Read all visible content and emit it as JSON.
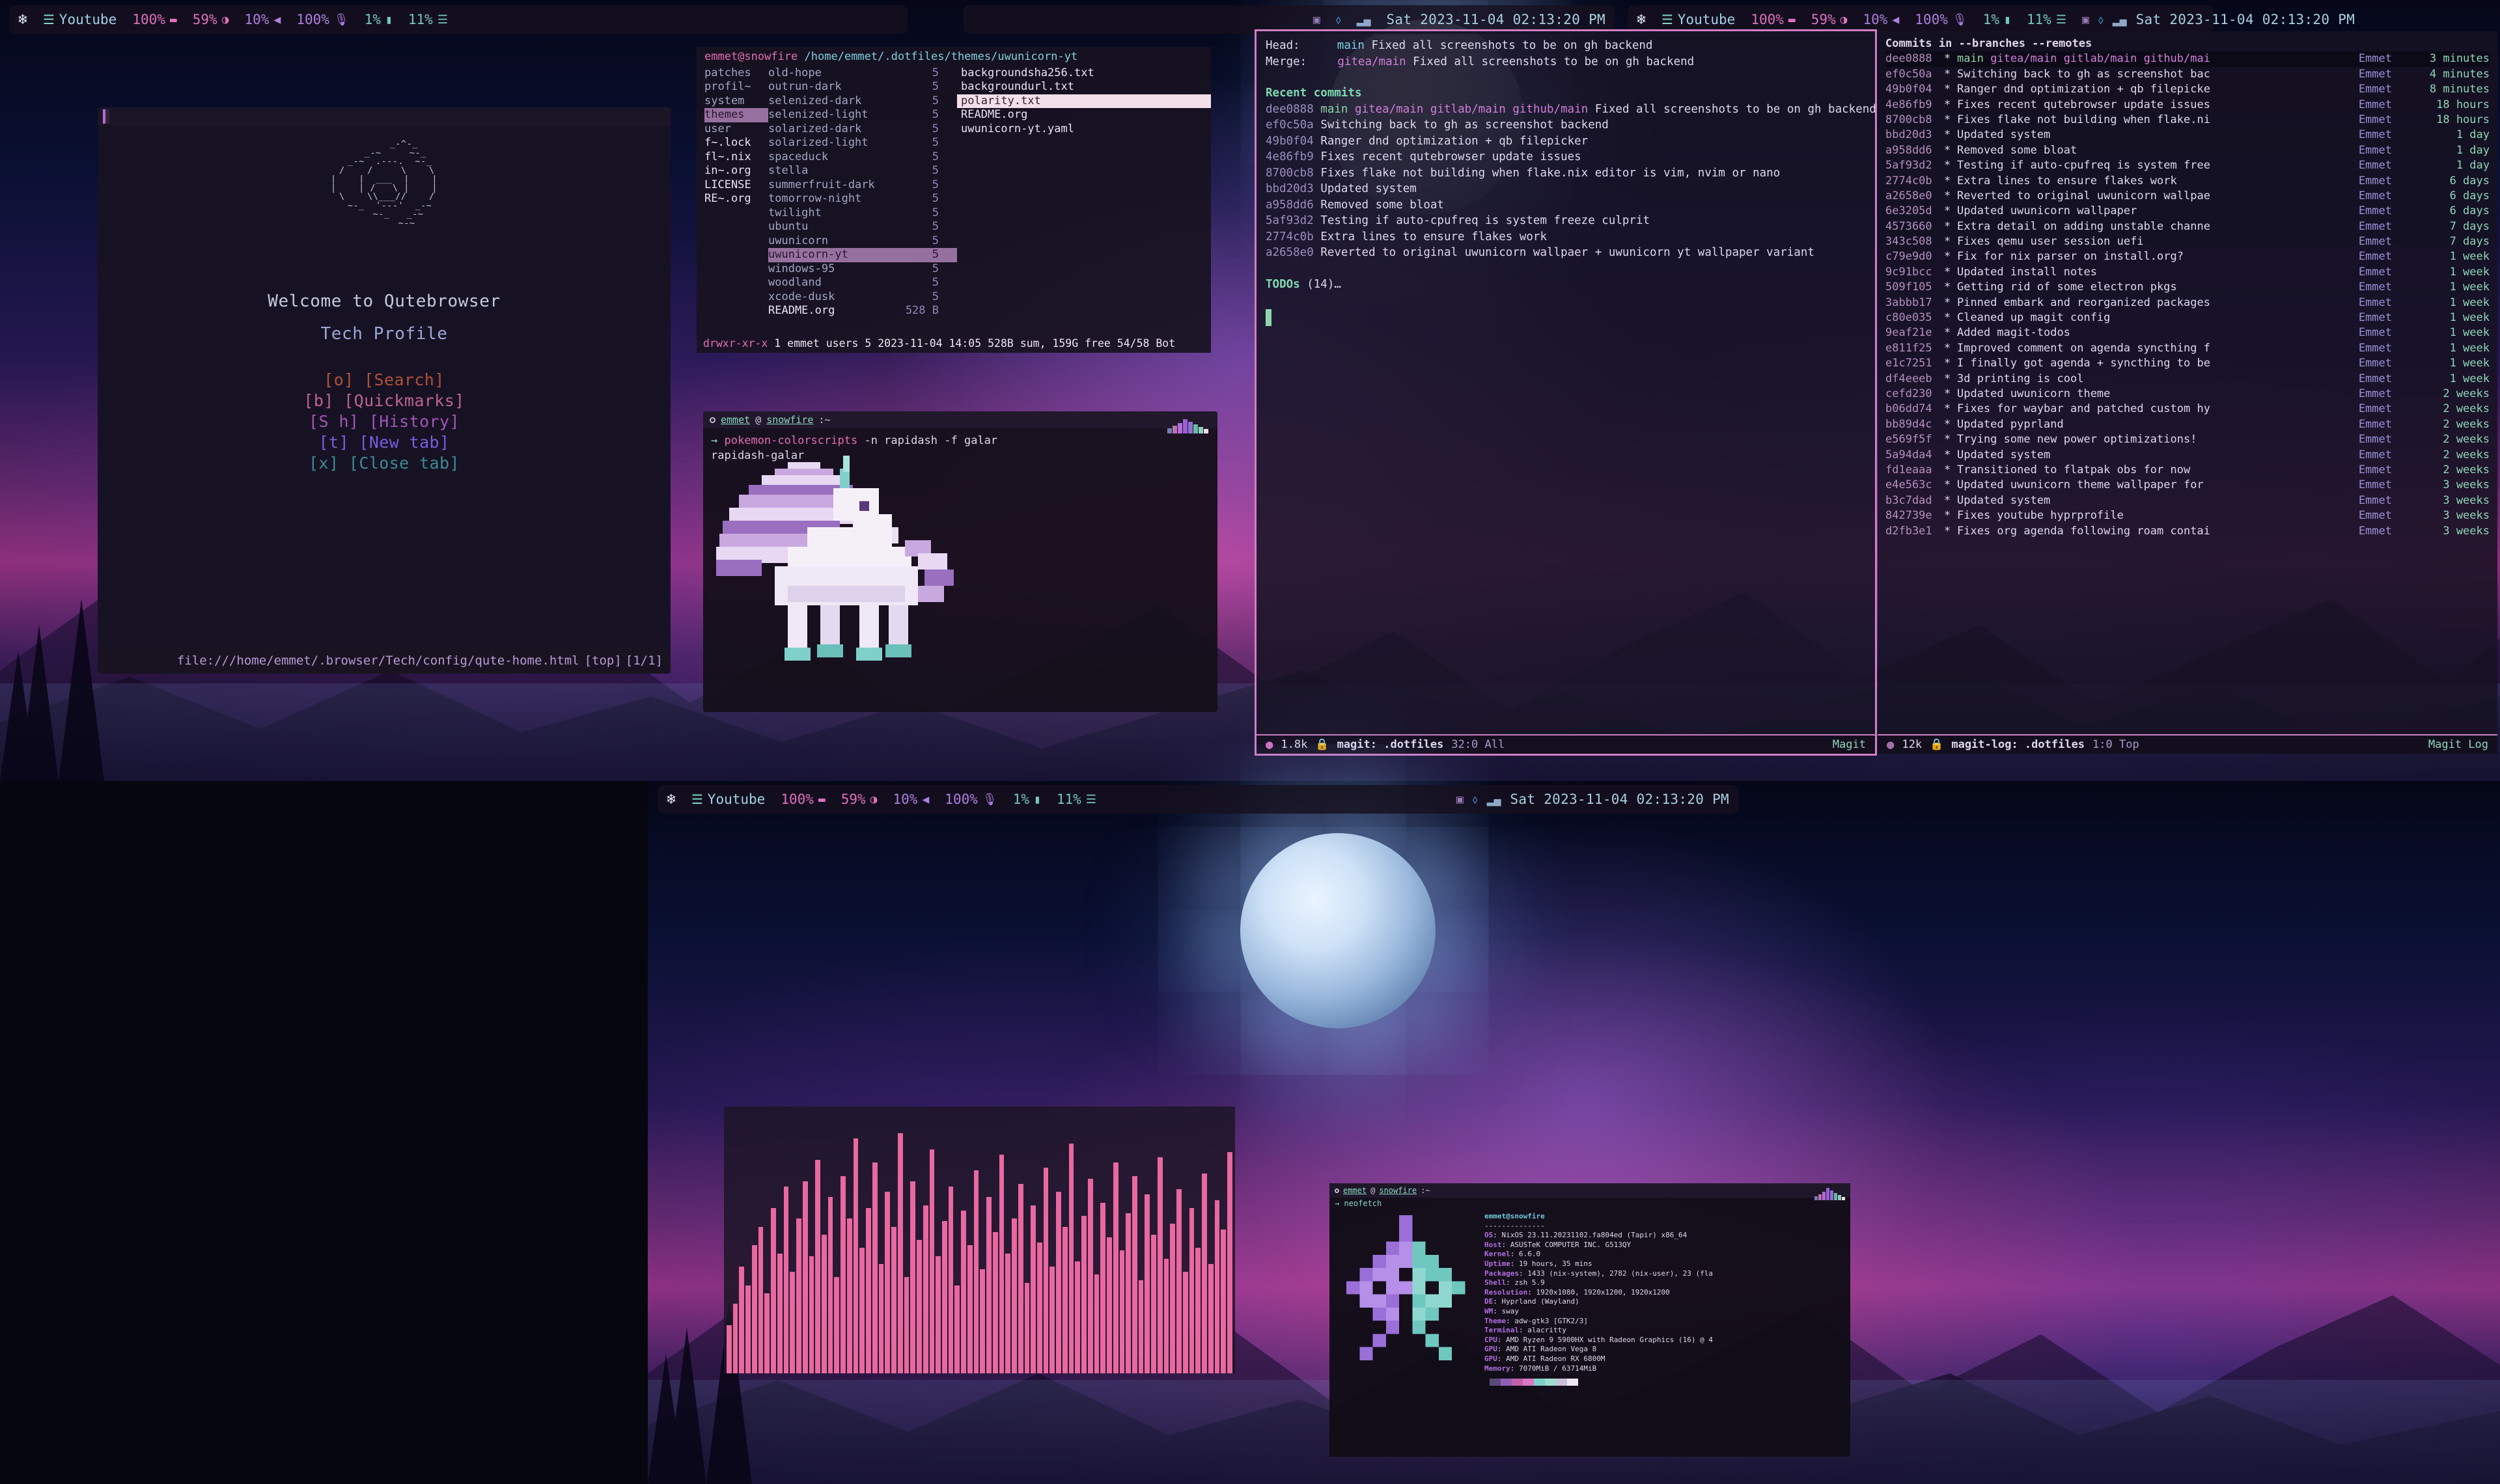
{
  "waybar": {
    "nix_icon": "nix-snowflake-icon",
    "workspace_icon": "layers-icon",
    "workspace_label": "Youtube",
    "brightness": "100%",
    "brightness_icon": "brightness-icon",
    "battery": "59%",
    "battery_icon": "battery-half-icon",
    "volume": "10%",
    "volume_icon": "speaker-icon",
    "mic": "100%",
    "mic_icon": "microphone-icon",
    "cpu": "1%",
    "cpu_icon": "cpu-icon",
    "memory": "11%",
    "memory_icon": "memory-icon",
    "tray_icons": [
      "display-off-icon",
      "bluetooth-icon",
      "network-signal-icon"
    ],
    "clock": "Sat 2023-11-04 02:13:20 PM"
  },
  "qutebrowser": {
    "ascii_art": "       _-^-_\n    _-~     ~-_\n  _-~  .---.  ~-_\n /    /     \\    \\\n|    |  ___  |    |\n|    | /   \\ |    |\n \\    \\\\___//    /\n  ~-_  '---'  _-~\n     ~-_   _-~\n        ~-~",
    "welcome": "Welcome to Qutebrowser",
    "subtitle": "Tech Profile",
    "links": [
      {
        "key": "[o]",
        "label": "[Search]",
        "color": "#b1503a"
      },
      {
        "key": "[b]",
        "label": "[Quickmarks]",
        "color": "#c0628f"
      },
      {
        "key": "[S h]",
        "label": "[History]",
        "color": "#a453b8"
      },
      {
        "key": "[t]",
        "label": "[New tab]",
        "color": "#7b5ce0"
      },
      {
        "key": "[x]",
        "label": "[Close tab]",
        "color": "#3d8a93"
      }
    ],
    "status_url": "file:///home/emmet/.browser/Tech/config/qute-home.html",
    "status_scroll": "[top]",
    "status_tabs": "[1/1]"
  },
  "ranger": {
    "user_host": "emmet@snowfire",
    "path": "/home/emmet/.dotfiles/themes/uwunicorn-yt",
    "col1": [
      {
        "name": "patches",
        "type": "dir"
      },
      {
        "name": "profil~",
        "type": "dir"
      },
      {
        "name": "system",
        "type": "dir"
      },
      {
        "name": "themes",
        "type": "dir",
        "selected": true
      },
      {
        "name": "user",
        "type": "dir"
      },
      {
        "name": "f~.lock",
        "type": "file"
      },
      {
        "name": "fl~.nix",
        "type": "file"
      },
      {
        "name": "in~.org",
        "type": "file"
      },
      {
        "name": "LICENSE",
        "type": "file"
      },
      {
        "name": "RE~.org",
        "type": "file"
      }
    ],
    "col2": [
      {
        "name": "old-hope",
        "size": "5"
      },
      {
        "name": "outrun-dark",
        "size": "5"
      },
      {
        "name": "selenized-dark",
        "size": "5"
      },
      {
        "name": "selenized-light",
        "size": "5"
      },
      {
        "name": "solarized-dark",
        "size": "5"
      },
      {
        "name": "solarized-light",
        "size": "5"
      },
      {
        "name": "spaceduck",
        "size": "5"
      },
      {
        "name": "stella",
        "size": "5"
      },
      {
        "name": "summerfruit-dark",
        "size": "5"
      },
      {
        "name": "tomorrow-night",
        "size": "5"
      },
      {
        "name": "twilight",
        "size": "5"
      },
      {
        "name": "ubuntu",
        "size": "5"
      },
      {
        "name": "uwunicorn",
        "size": "5"
      },
      {
        "name": "uwunicorn-yt",
        "size": "5",
        "selected": true
      },
      {
        "name": "windows-95",
        "size": "5"
      },
      {
        "name": "woodland",
        "size": "5"
      },
      {
        "name": "xcode-dusk",
        "size": "5"
      },
      {
        "name": "README.org",
        "size": "528 B",
        "file": true
      }
    ],
    "col3": [
      {
        "name": "backgroundsha256.txt"
      },
      {
        "name": "backgroundurl.txt"
      },
      {
        "name": "polarity.txt",
        "selected": true
      },
      {
        "name": "README.org"
      },
      {
        "name": "uwunicorn-yt.yaml"
      }
    ],
    "statusline_perm": "drwxr-xr-x",
    "statusline_rest": "1 emmet users 5 2023-11-04 14:05 528B sum, 159G free  54/58  Bot"
  },
  "pokemon_terminal": {
    "title_user": "emmet",
    "title_at": "@",
    "title_host": "snowfire",
    "title_path": ":~",
    "prompt_arrow": "→",
    "command": "pokemon-colorscripts",
    "args": "-n rapidash -f galar",
    "output": "rapidash-galar",
    "swatch_colors": [
      "#6f7fb8",
      "#c06fb0",
      "#b06fd8",
      "#9a5fd8",
      "#8f6fd0",
      "#6fb8a8",
      "#8fd0c0",
      "#f0dce8"
    ],
    "swatch_heights": [
      8,
      12,
      16,
      22,
      18,
      14,
      10,
      7
    ],
    "pokemon_name": "rapidash-galar",
    "pokemon_colors": {
      "mane_light": "#e8d8f2",
      "mane_mid": "#c9a8e0",
      "mane_dark": "#9a6fc0",
      "body": "#f5f0f8",
      "accent": "#7fd0c8",
      "shadow": "#6a4a8a"
    }
  },
  "magit": {
    "head_label": "Head:",
    "head_branch": "main",
    "head_msg": "Fixed all screenshots to be on gh backend",
    "merge_label": "Merge:",
    "merge_branch": "gitea/main",
    "merge_msg": "Fixed all screenshots to be on gh backend",
    "recent_commits_label": "Recent commits",
    "commits": [
      {
        "hash": "dee0888",
        "refs": [
          "main",
          "gitea/main",
          "gitlab/main",
          "github/main"
        ],
        "msg": "Fixed all screenshots to be on gh backend"
      },
      {
        "hash": "ef0c50a",
        "refs": [],
        "msg": "Switching back to gh as screenshot backend"
      },
      {
        "hash": "49b0f04",
        "refs": [],
        "msg": "Ranger dnd optimization + qb filepicker"
      },
      {
        "hash": "4e86fb9",
        "refs": [],
        "msg": "Fixes recent qutebrowser update issues"
      },
      {
        "hash": "8700cb8",
        "refs": [],
        "msg": "Fixes flake not building when flake.nix editor is vim, nvim or nano"
      },
      {
        "hash": "bbd20d3",
        "refs": [],
        "msg": "Updated system"
      },
      {
        "hash": "a958dd6",
        "refs": [],
        "msg": "Removed some bloat"
      },
      {
        "hash": "5af93d2",
        "refs": [],
        "msg": "Testing if auto-cpufreq is system freeze culprit"
      },
      {
        "hash": "2774c0b",
        "refs": [],
        "msg": "Extra lines to ensure flakes work"
      },
      {
        "hash": "a2658e0",
        "refs": [],
        "msg": "Reverted to original uwunicorn wallpaer + uwunicorn yt wallpaper variant"
      }
    ],
    "todos_label": "TODOs",
    "todos_count": "(14)…",
    "modeline": {
      "size": "1.8k",
      "lock_icon": "lock-icon",
      "buffer": "magit: .dotfiles",
      "position": "32:0 All",
      "mode": "Magit"
    }
  },
  "magit_log": {
    "header": "Commits in --branches --remotes",
    "rows": [
      {
        "hash": "dee0888",
        "msg": "main gitea/main gitlab/main github/mai",
        "refs": true,
        "author": "Emmet",
        "age": "3 minutes",
        "current": true
      },
      {
        "hash": "ef0c50a",
        "msg": "Switching back to gh as screenshot bac",
        "author": "Emmet",
        "age": "4 minutes"
      },
      {
        "hash": "49b0f04",
        "msg": "Ranger dnd optimization + qb filepicke",
        "author": "Emmet",
        "age": "8 minutes"
      },
      {
        "hash": "4e86fb9",
        "msg": "Fixes recent qutebrowser update issues",
        "author": "Emmet",
        "age": "18 hours"
      },
      {
        "hash": "8700cb8",
        "msg": "Fixes flake not building when flake.ni",
        "author": "Emmet",
        "age": "18 hours"
      },
      {
        "hash": "bbd20d3",
        "msg": "Updated system",
        "author": "Emmet",
        "age": "1 day"
      },
      {
        "hash": "a958dd6",
        "msg": "Removed some bloat",
        "author": "Emmet",
        "age": "1 day"
      },
      {
        "hash": "5af93d2",
        "msg": "Testing if auto-cpufreq is system free",
        "author": "Emmet",
        "age": "1 day"
      },
      {
        "hash": "2774c0b",
        "msg": "Extra lines to ensure flakes work",
        "author": "Emmet",
        "age": "6 days"
      },
      {
        "hash": "a2658e0",
        "msg": "Reverted to original uwunicorn wallpae",
        "author": "Emmet",
        "age": "6 days"
      },
      {
        "hash": "6e3205d",
        "msg": "Updated uwunicorn wallpaper",
        "author": "Emmet",
        "age": "6 days"
      },
      {
        "hash": "4573660",
        "msg": "Extra detail on adding unstable channe",
        "author": "Emmet",
        "age": "7 days"
      },
      {
        "hash": "343c508",
        "msg": "Fixes qemu user session uefi",
        "author": "Emmet",
        "age": "7 days"
      },
      {
        "hash": "c79e9d0",
        "msg": "Fix for nix parser on install.org?",
        "author": "Emmet",
        "age": "1 week"
      },
      {
        "hash": "9c91bcc",
        "msg": "Updated install notes",
        "author": "Emmet",
        "age": "1 week"
      },
      {
        "hash": "509f105",
        "msg": "Getting rid of some electron pkgs",
        "author": "Emmet",
        "age": "1 week"
      },
      {
        "hash": "3abbb17",
        "msg": "Pinned embark and reorganized packages",
        "author": "Emmet",
        "age": "1 week"
      },
      {
        "hash": "c80e035",
        "msg": "Cleaned up magit config",
        "author": "Emmet",
        "age": "1 week"
      },
      {
        "hash": "9eaf21e",
        "msg": "Added magit-todos",
        "author": "Emmet",
        "age": "1 week"
      },
      {
        "hash": "e811f25",
        "msg": "Improved comment on agenda syncthing f",
        "author": "Emmet",
        "age": "1 week"
      },
      {
        "hash": "e1c7251",
        "msg": "I finally got agenda + syncthing to be",
        "author": "Emmet",
        "age": "1 week"
      },
      {
        "hash": "df4eeeb",
        "msg": "3d printing is cool",
        "author": "Emmet",
        "age": "1 week"
      },
      {
        "hash": "cefd230",
        "msg": "Updated uwunicorn theme",
        "author": "Emmet",
        "age": "2 weeks"
      },
      {
        "hash": "b06dd74",
        "msg": "Fixes for waybar and patched custom hy",
        "author": "Emmet",
        "age": "2 weeks"
      },
      {
        "hash": "bb89d4c",
        "msg": "Updated pyprland",
        "author": "Emmet",
        "age": "2 weeks"
      },
      {
        "hash": "e569f5f",
        "msg": "Trying some new power optimizations!",
        "author": "Emmet",
        "age": "2 weeks"
      },
      {
        "hash": "5a94da4",
        "msg": "Updated system",
        "author": "Emmet",
        "age": "2 weeks"
      },
      {
        "hash": "fd1eaaa",
        "msg": "Transitioned to flatpak obs for now",
        "author": "Emmet",
        "age": "2 weeks"
      },
      {
        "hash": "e4e563c",
        "msg": "Updated uwunicorn theme wallpaper for",
        "author": "Emmet",
        "age": "3 weeks"
      },
      {
        "hash": "b3c7dad",
        "msg": "Updated system",
        "author": "Emmet",
        "age": "3 weeks"
      },
      {
        "hash": "842739e",
        "msg": "Fixes youtube hyprprofile",
        "author": "Emmet",
        "age": "3 weeks"
      },
      {
        "hash": "d2fb3e1",
        "msg": "Fixes org agenda following roam contai",
        "author": "Emmet",
        "age": "3 weeks"
      }
    ],
    "modeline": {
      "size": "12k",
      "lock_icon": "lock-icon",
      "buffer": "magit-log: .dotfiles",
      "position": "1:0 Top",
      "mode": "Magit Log"
    }
  },
  "waybar_bottom": {
    "nix_icon": "nix-snowflake-icon",
    "workspace_icon": "layers-icon",
    "workspace_label": "Youtube",
    "brightness": "100%",
    "battery": "59%",
    "volume": "10%",
    "mic": "100%",
    "cpu": "1%",
    "memory": "11%",
    "tray_icons": [
      "display-off-icon",
      "bluetooth-icon",
      "network-signal-icon"
    ],
    "clock": "Sat 2023-11-04 02:13:20 PM"
  },
  "cava": {
    "name": "cava-visualizer",
    "bar_color": "#e8689f",
    "levels": [
      18,
      26,
      40,
      33,
      48,
      55,
      30,
      62,
      45,
      70,
      38,
      58,
      72,
      44,
      80,
      52,
      66,
      36,
      74,
      58,
      88,
      47,
      62,
      79,
      41,
      68,
      55,
      90,
      36,
      72,
      50,
      63,
      84,
      44,
      57,
      70,
      33,
      61,
      48,
      76,
      39,
      66,
      53,
      82,
      45,
      58,
      71,
      34,
      63,
      49,
      77,
      40,
      68,
      55,
      86,
      42,
      59,
      73,
      37,
      64,
      51,
      79,
      46,
      60,
      74,
      35,
      67,
      52,
      81,
      43,
      56,
      69,
      38,
      62,
      47,
      75,
      41,
      65,
      54,
      83
    ]
  },
  "neofetch": {
    "title_user": "emmet",
    "title_at": "@",
    "title_host": "snowfire",
    "title_path": ":~",
    "prompt": "→ neofetch",
    "user_host": "emmet@snowfire",
    "rule": "--------------",
    "rows": [
      {
        "key": "OS",
        "value": "NixOS 23.11.20231102.fa804ed (Tapir) x86_64"
      },
      {
        "key": "Host",
        "value": "ASUSTeK COMPUTER INC. G513QY"
      },
      {
        "key": "Kernel",
        "value": "6.6.0"
      },
      {
        "key": "Uptime",
        "value": "19 hours, 35 mins"
      },
      {
        "key": "Packages",
        "value": "1433 (nix-system), 2782 (nix-user), 23 (fla"
      },
      {
        "key": "Shell",
        "value": "zsh 5.9"
      },
      {
        "key": "Resolution",
        "value": "1920x1080, 1920x1200, 1920x1200"
      },
      {
        "key": "DE",
        "value": "Hyprland (Wayland)"
      },
      {
        "key": "WM",
        "value": "sway"
      },
      {
        "key": "Theme",
        "value": "adw-gtk3 [GTK2/3]"
      },
      {
        "key": "Terminal",
        "value": "alacritty"
      },
      {
        "key": "CPU",
        "value": "AMD Ryzen 9 5900HX with Radeon Graphics (16) @ 4"
      },
      {
        "key": "GPU",
        "value": "AMD ATI Radeon Vega 8"
      },
      {
        "key": "GPU",
        "value": "AMD ATI Radeon RX 6800M"
      },
      {
        "key": "Memory",
        "value": "7070MiB / 63714MiB"
      }
    ],
    "palette": [
      "#5a4a78",
      "#8f5fb8",
      "#c060a8",
      "#d878c0",
      "#7fd0c8",
      "#9fdcd0",
      "#c8c0d8",
      "#efe6f2"
    ],
    "logo_name": "nixos-logo",
    "logo_colors": [
      "#9a6fd8",
      "#b58fe8",
      "#6fc8c0",
      "#8fd8d0"
    ],
    "corner_swatch": [
      "#6f7fb8",
      "#c06fb0",
      "#b06fd8",
      "#9a5fd8",
      "#8f6fd0",
      "#6fb8a8",
      "#8fd0c0",
      "#f0dce8"
    ]
  }
}
